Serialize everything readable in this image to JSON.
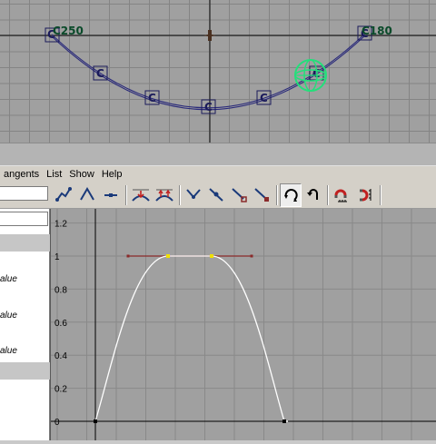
{
  "viewport": {
    "cv_labels": [
      "C250",
      "C180"
    ],
    "colors": {
      "curve": "#2a2a7a",
      "cv": "#1a1a5a",
      "manipulator": "#22e07a"
    }
  },
  "menu": {
    "items": [
      "angents",
      "List",
      "Show",
      "Help"
    ]
  },
  "toolbar": {
    "icons": [
      "spline-tangents-icon",
      "linear-tangents-icon",
      "flat-tangents-icon",
      "stepped-tangents-icon",
      "clamped-tangents-icon",
      "break-tangents-icon",
      "unify-tangents-icon",
      "free-tangent-weight-icon",
      "lock-tangent-weight-icon",
      "buffer-curve-snapshot-icon",
      "swap-buffer-curves-icon",
      "curve-infinity-icon",
      "curve-infinity-offset-icon"
    ]
  },
  "outliner": {
    "items": [
      "alue",
      "alue",
      "alue"
    ]
  },
  "chart_data": {
    "type": "line",
    "title": "",
    "xlabel": "",
    "ylabel": "",
    "yticks": [
      "0",
      "0.2",
      "0.4",
      "0.6",
      "0.8",
      "1",
      "1.2"
    ],
    "ylim": [
      0,
      1.2
    ],
    "series": [
      {
        "keys": [
          [
            0,
            0
          ],
          [
            2.5,
            1
          ],
          [
            4,
            1
          ],
          [
            6.5,
            0
          ]
        ]
      }
    ],
    "selected_keys_y": 1,
    "colors": {
      "curve": "#ffffff",
      "tangent": "#8a2a2a",
      "selected_key": "#f0e000"
    }
  }
}
